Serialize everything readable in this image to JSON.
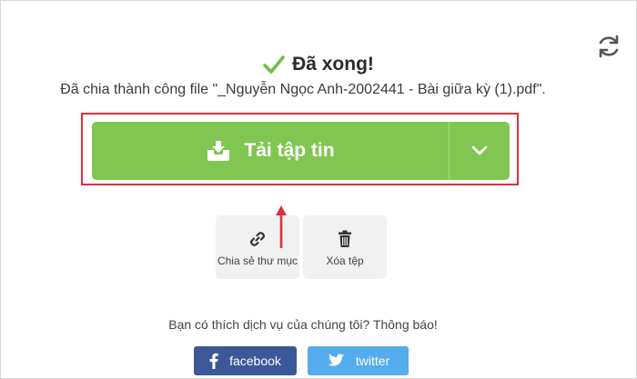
{
  "header": {
    "title": "Đã xong!",
    "subtitle": "Đã chia thành công file \"_Nguyễn Ngọc Anh-2002441 - Bài giữa kỳ (1).pdf\"."
  },
  "actions": {
    "download_label": "Tải tập tin",
    "share_folder_label": "Chia sẻ thư mục",
    "delete_label": "Xóa tệp"
  },
  "promo": {
    "text": "Bạn có thích dịch vụ của chúng tôi? Thông báo!",
    "facebook_label": "facebook",
    "twitter_label": "twitter"
  },
  "icons": {
    "refresh": "refresh-icon",
    "check": "checkmark-icon",
    "download": "download-tray-icon",
    "dropdown": "chevron-down-icon",
    "link": "link-icon",
    "trash": "trash-icon",
    "facebook": "facebook-icon",
    "twitter": "twitter-icon"
  },
  "colors": {
    "primary_green": "#80c650",
    "check_green": "#6bbf45",
    "highlight_red": "#d9323c",
    "facebook_blue": "#3b5998",
    "twitter_blue": "#55acee"
  }
}
